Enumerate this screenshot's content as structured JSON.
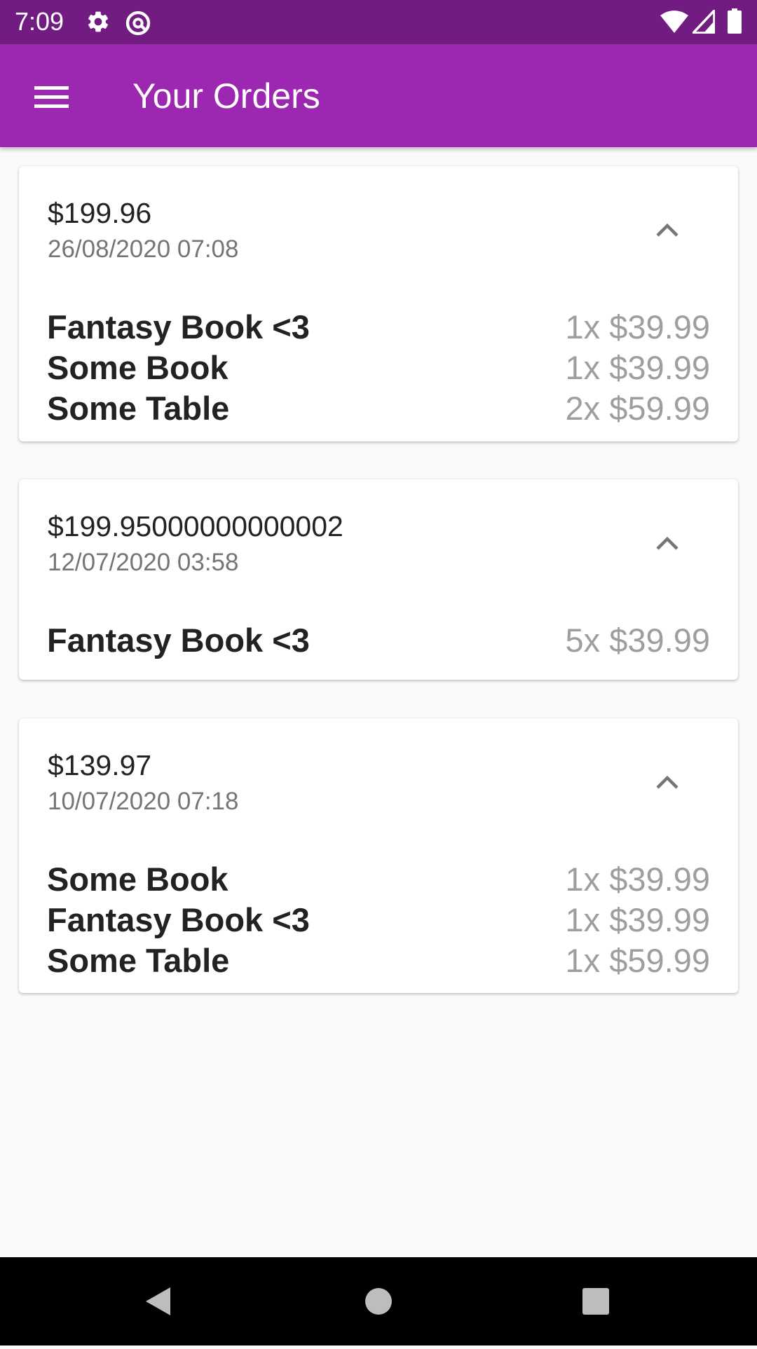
{
  "status_bar": {
    "time": "7:09",
    "icons": [
      "gear-icon",
      "at-sign-icon",
      "wifi-icon",
      "cell-signal-icon",
      "battery-icon"
    ]
  },
  "app_bar": {
    "title": "Your Orders",
    "menu_icon": "hamburger-menu-icon"
  },
  "orders": [
    {
      "total": "$199.96",
      "date": "26/08/2020 07:08",
      "items": [
        {
          "name": "Fantasy Book <3",
          "qty": "1x $39.99"
        },
        {
          "name": "Some Book",
          "qty": "1x $39.99"
        },
        {
          "name": "Some Table",
          "qty": "2x $59.99"
        }
      ]
    },
    {
      "total": "$199.95000000000002",
      "date": "12/07/2020 03:58",
      "items": [
        {
          "name": "Fantasy Book <3",
          "qty": "5x $39.99"
        }
      ]
    },
    {
      "total": "$139.97",
      "date": "10/07/2020 07:18",
      "items": [
        {
          "name": "Some Book",
          "qty": "1x $39.99"
        },
        {
          "name": "Fantasy Book <3",
          "qty": "1x $39.99"
        },
        {
          "name": "Some Table",
          "qty": "1x $59.99"
        }
      ]
    }
  ],
  "nav_bar": {
    "icons": [
      "back-icon",
      "home-icon",
      "recents-icon"
    ]
  },
  "colors": {
    "status_bar": "#721c81",
    "app_bar": "#9c27b0",
    "background": "#fafafa",
    "secondary_text": "#757575",
    "quantity_text": "#9e9e9e"
  }
}
